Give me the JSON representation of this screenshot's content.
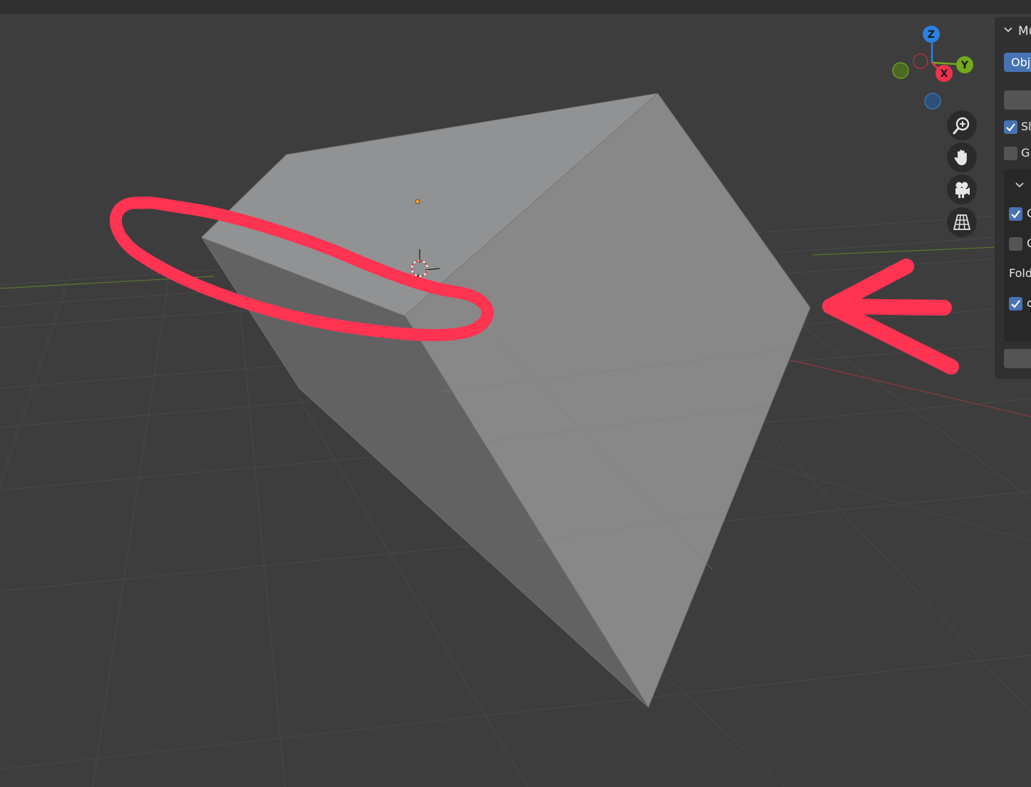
{
  "viewport": {
    "background": "#3d3d3d",
    "topbar_color": "#303030"
  },
  "gizmo": {
    "z_label": "Z",
    "y_label": "Y",
    "x_label": "X",
    "colors": {
      "x": "#f0324d",
      "y": "#74a91d",
      "z": "#2c80e0"
    }
  },
  "nav_buttons": [
    {
      "name": "zoom-icon"
    },
    {
      "name": "hand-pan-icon"
    },
    {
      "name": "camera-icon"
    },
    {
      "name": "perspective-grid-icon"
    }
  ],
  "npanel": {
    "title": "Mu",
    "mode_button": "Obj",
    "items": [
      {
        "label": "Sl",
        "checked": true
      },
      {
        "label": "G",
        "checked": false
      }
    ],
    "subpanel_items": [
      {
        "label": "C",
        "checked": true
      },
      {
        "label": "C",
        "checked": false
      },
      {
        "label": "Fold"
      },
      {
        "label": "c",
        "checked": true
      }
    ]
  },
  "annotation_color": "#ff3352"
}
